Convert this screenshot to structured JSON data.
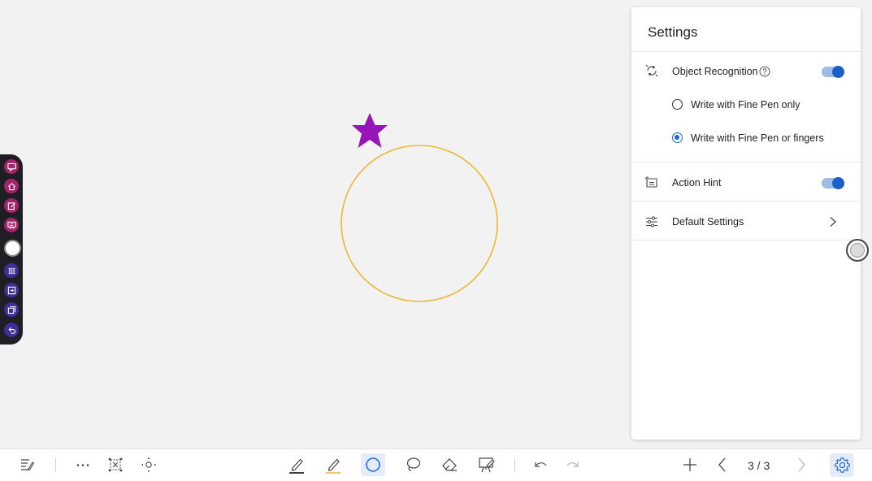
{
  "settings": {
    "title": "Settings",
    "object_recognition": {
      "label": "Object Recognition",
      "enabled": true
    },
    "options": [
      {
        "label": "Write with Fine Pen only",
        "selected": false
      },
      {
        "label": "Write with Fine Pen or fingers",
        "selected": true
      }
    ],
    "action_hint": {
      "label": "Action Hint",
      "enabled": true
    },
    "default_settings": {
      "label": "Default Settings"
    }
  },
  "pagination": {
    "page_label": "3 / 3"
  },
  "colors": {
    "canvas_bg": "#f2f2f2",
    "star": "#9515b5",
    "circle_stroke": "#eab832",
    "accent": "#1a66d4",
    "toggle_track": "#9cbbe5",
    "highlighter": "#f6c663"
  },
  "toolbar_icons": [
    "menu-list-icon",
    "more-icon",
    "select-icon",
    "move-icon",
    "pen-icon",
    "highlighter-icon",
    "circle-shape-icon",
    "lasso-icon",
    "eraser-icon",
    "board-icon",
    "undo-icon",
    "redo-icon",
    "add-page-icon",
    "prev-page-icon",
    "next-page-icon",
    "settings-gear-icon"
  ]
}
